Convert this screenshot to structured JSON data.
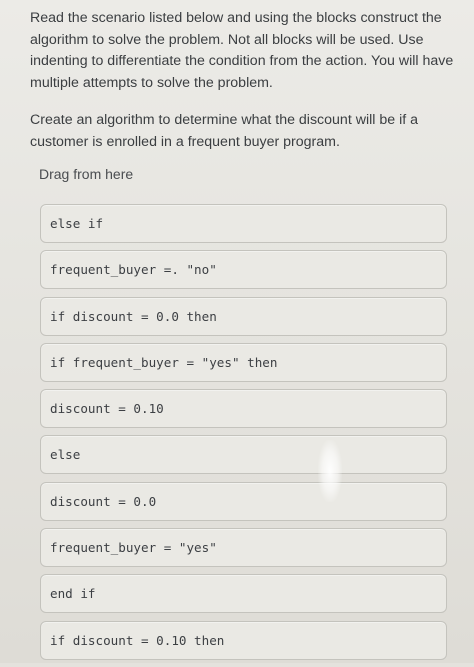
{
  "instructions": {
    "paragraph": "Read the scenario listed below and using the blocks construct the algorithm to solve the problem. Not all blocks will be used. Use indenting to differentiate the condition from the action. You will have multiple attempts to solve the problem.",
    "question": "Create an algorithm to determine what the discount will be if a customer is enrolled in a frequent buyer program."
  },
  "drag_area": {
    "label": "Drag from here"
  },
  "blocks": [
    {
      "code": "else if"
    },
    {
      "code": "frequent_buyer =. \"no\""
    },
    {
      "code": "if discount = 0.0 then"
    },
    {
      "code": "if frequent_buyer = \"yes\" then"
    },
    {
      "code": "discount = 0.10"
    },
    {
      "code": "else"
    },
    {
      "code": "discount = 0.0"
    },
    {
      "code": "frequent_buyer = \"yes\""
    },
    {
      "code": "end if"
    },
    {
      "code": "if discount = 0.10 then"
    }
  ]
}
